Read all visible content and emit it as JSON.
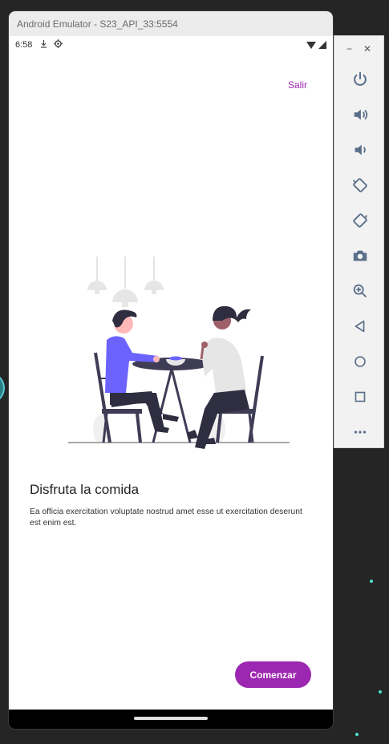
{
  "window": {
    "title": "Android Emulator - S23_API_33:5554"
  },
  "status_bar": {
    "time": "6:58"
  },
  "onboarding": {
    "skip_label": "Salir",
    "title": "Disfruta la comida",
    "description": "Ea officia exercitation voluptate nostrud amet esse ut exercitation deserunt est enim est.",
    "cta_label": "Comenzar"
  },
  "toolbar": {
    "minimize": "−",
    "close": "✕",
    "buttons": [
      {
        "icon": "power-icon"
      },
      {
        "icon": "volume-up-icon"
      },
      {
        "icon": "volume-down-icon"
      },
      {
        "icon": "rotate-left-icon"
      },
      {
        "icon": "rotate-right-icon"
      },
      {
        "icon": "camera-icon"
      },
      {
        "icon": "zoom-icon"
      },
      {
        "icon": "back-icon"
      },
      {
        "icon": "home-icon"
      },
      {
        "icon": "overview-icon"
      },
      {
        "icon": "more-icon"
      }
    ]
  },
  "colors": {
    "accent": "#9c27b0",
    "illustration_accent": "#6c63ff",
    "toolbar_icon": "#5b6f8a"
  }
}
